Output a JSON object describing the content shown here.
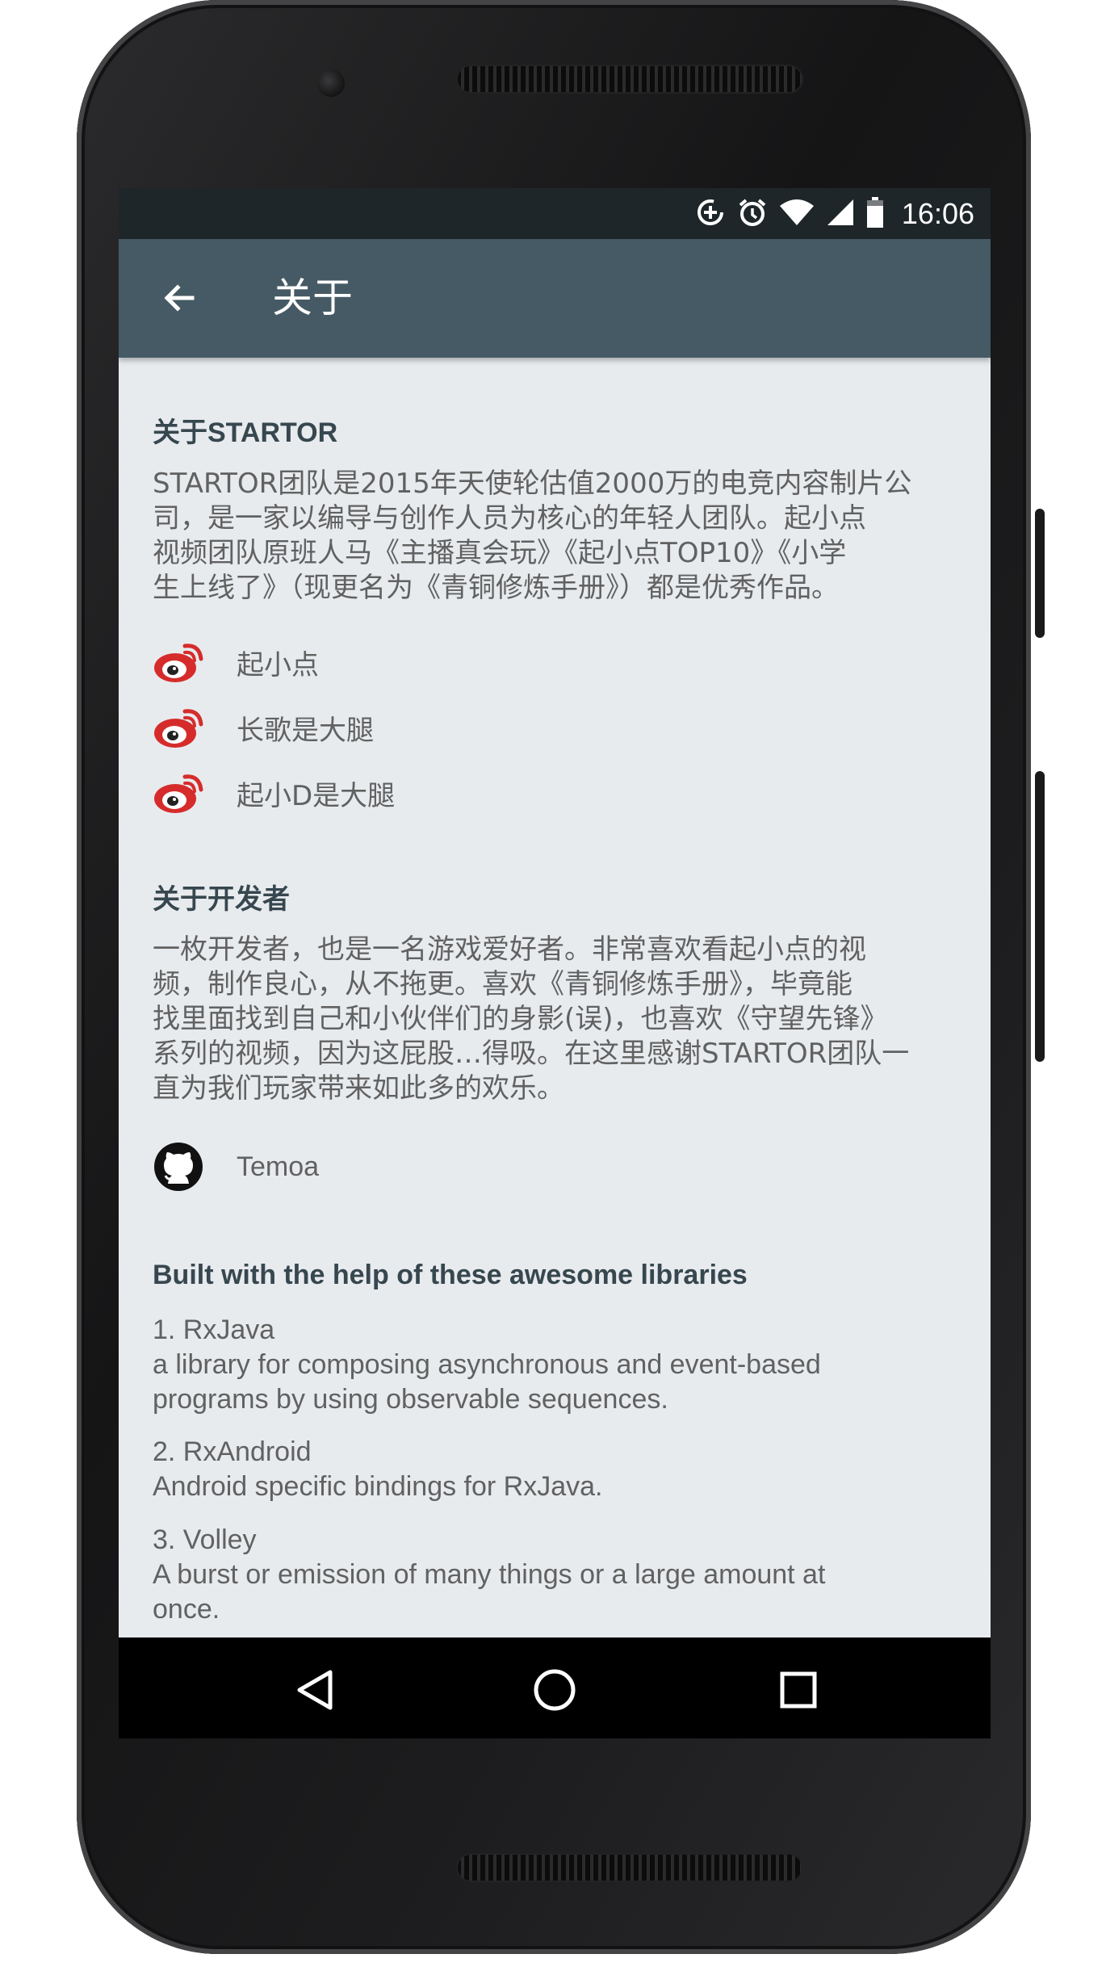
{
  "status_bar": {
    "time": "16:06",
    "icons": [
      "data-saver-icon",
      "alarm-icon",
      "wifi-icon",
      "signal-icon",
      "battery-icon"
    ]
  },
  "app_bar": {
    "back_icon": "arrow-back-icon",
    "title": "关于"
  },
  "startor": {
    "title": "关于STARTOR",
    "description": "STARTOR团队是2015年天使轮估值2000万的电竞内容制片公\n司，是一家以编导与创作人员为核心的年轻人团队。起小点\n视频团队原班人马《主播真会玩》《起小点TOP10》《小学\n生上线了》（现更名为《青铜修炼手册》）都是优秀作品。",
    "links": [
      {
        "icon": "weibo-icon",
        "label": "起小点"
      },
      {
        "icon": "weibo-icon",
        "label": "长歌是大腿"
      },
      {
        "icon": "weibo-icon",
        "label": "起小D是大腿"
      }
    ]
  },
  "developer": {
    "title": "关于开发者",
    "description": "一枚开发者，也是一名游戏爱好者。非常喜欢看起小点的视\n频，制作良心，从不拖更。喜欢《青铜修炼手册》，毕竟能\n找里面找到自己和小伙伴们的身影(误)，也喜欢《守望先锋》\n系列的视频，因为这屁股…得吸。在这里感谢STARTOR团队一\n直为我们玩家带来如此多的欢乐。",
    "github": {
      "icon": "github-icon",
      "label": "Temoa"
    }
  },
  "libraries": {
    "title": "Built with the help of these awesome libraries",
    "items": [
      {
        "text": "1. RxJava\n a library for composing asynchronous and event-based\nprograms by using observable sequences."
      },
      {
        "text": "2. RxAndroid\n Android specific bindings for RxJava."
      },
      {
        "text": "3. Volley\n A burst or emission of many things or a large amount at\nonce."
      }
    ]
  },
  "nav_bar": {
    "back": "nav-back-icon",
    "home": "nav-home-icon",
    "recents": "nav-recents-icon"
  },
  "colors": {
    "app_bar": "#455a64",
    "status_bar": "#1e2629",
    "background": "#e8ebee",
    "weibo_red": "#d52c2b",
    "title_text": "#37474f",
    "body_text": "#616161"
  }
}
